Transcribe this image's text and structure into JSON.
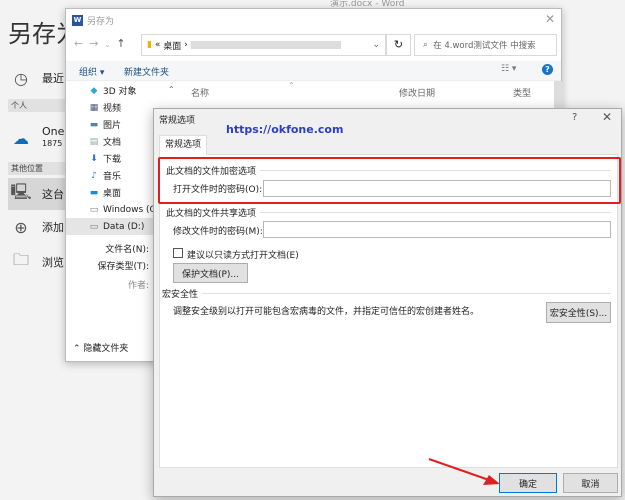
{
  "word_title": "演示.docx - Word",
  "backstage": {
    "title": "另存为",
    "recent": "最近",
    "personal": "个人",
    "onedrive": "One",
    "onedrive_sub": "1875",
    "other": "其他位置",
    "this_pc": "这台",
    "add": "添加",
    "browse": "浏览"
  },
  "saveas": {
    "title": "另存为",
    "path": "桌面",
    "search_placeholder": "在 4.word测试文件 中搜索",
    "organize": "组织 ▾",
    "new_folder": "新建文件夹",
    "nav": [
      {
        "icon": "3d-objects-icon",
        "label": "3D 对象"
      },
      {
        "icon": "video-icon",
        "label": "视频"
      },
      {
        "icon": "pictures-icon",
        "label": "图片"
      },
      {
        "icon": "documents-icon",
        "label": "文档"
      },
      {
        "icon": "downloads-icon",
        "label": "下载"
      },
      {
        "icon": "music-icon",
        "label": "音乐"
      },
      {
        "icon": "desktop-icon",
        "label": "桌面"
      },
      {
        "icon": "drive-icon",
        "label": "Windows (C:)"
      },
      {
        "icon": "drive-icon",
        "label": "Data (D:)"
      }
    ],
    "columns": [
      "名称",
      "修改日期",
      "类型"
    ],
    "filename_label": "文件名(N):",
    "savetype_label": "保存类型(T):",
    "author_label": "作者:",
    "hide_folders": "隐藏文件夹"
  },
  "options": {
    "title": "常规选项",
    "help": "?",
    "watermark": "https://okfone.com",
    "tab": "常规选项",
    "encrypt_section": "此文档的文件加密选项",
    "open_pw_label": "打开文件时的密码(O):",
    "open_pw": "",
    "share_section": "此文档的文件共享选项",
    "modify_pw_label": "修改文件时的密码(M):",
    "modify_pw": "",
    "readonly_label": "建议以只读方式打开文档(E)",
    "readonly_checked": false,
    "protect_btn": "保护文档(P)...",
    "macro_section": "宏安全性",
    "macro_desc": "调整安全级别以打开可能包含宏病毒的文件，并指定可信任的宏创建者姓名。",
    "macro_btn": "宏安全性(S)...",
    "ok": "确定",
    "cancel": "取消"
  },
  "colors": {
    "highlight": "#e02020",
    "watermark": "#2b3fbf",
    "ok_border": "#0078d7"
  }
}
